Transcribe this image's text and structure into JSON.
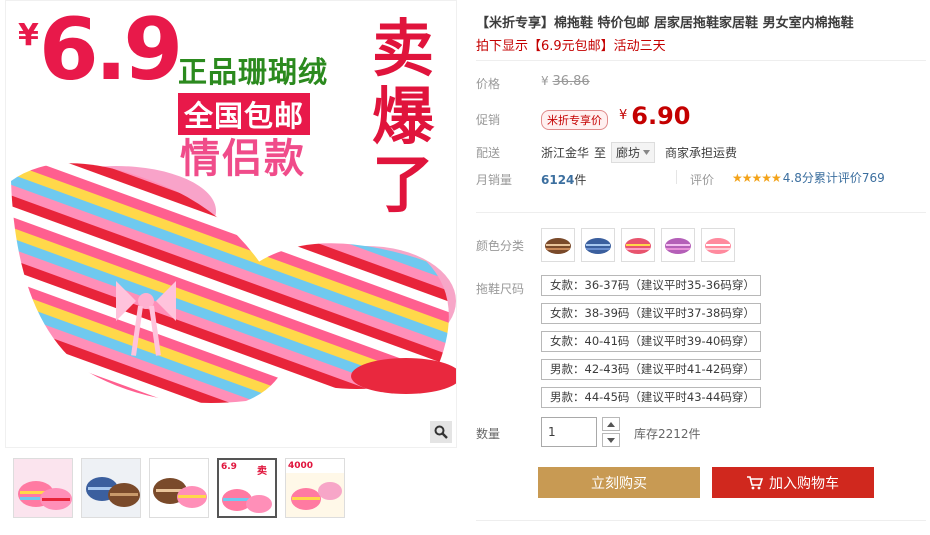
{
  "gallery": {
    "promo": {
      "yen": "¥",
      "price": "6.9",
      "line1": "正品珊瑚绒",
      "line2": "全国包邮",
      "line3": "情侣款",
      "vertical": "卖爆了"
    },
    "thumb4_caption": "6.9",
    "thumb5_caption": "4000"
  },
  "product": {
    "title": "【米折专享】棉拖鞋 特价包邮 居家居拖鞋家居鞋 男女室内棉拖鞋",
    "subtitle": "拍下显示【6.9元包邮】活动三天",
    "price_label": "价格",
    "orig_yen": "¥",
    "orig_price": "36.86",
    "promo_label": "促销",
    "promo_tag": "米折专享价",
    "cur_yen": "¥",
    "cur_price": "6.90",
    "ship_label": "配送",
    "ship_from": "浙江金华",
    "ship_to": "至",
    "ship_city": "廊坊",
    "ship_fee": "商家承担运费",
    "sales_label": "月销量",
    "sales_count": "6124",
    "sales_unit": "件",
    "rating_label": "评价",
    "rating_stars": "★★★★★",
    "rating_text": "4.8分累计评价769",
    "color_label": "颜色分类",
    "size_label": "拖鞋尺码",
    "sizes": [
      "女款：36-37码（建议平时35-36码穿）",
      "女款：38-39码（建议平时37-38码穿）",
      "女款：40-41码（建议平时39-40码穿）",
      "男款：42-43码（建议平时41-42码穿）",
      "男款：44-45码（建议平时43-44码穿）"
    ],
    "qty_label": "数量",
    "qty_value": "1",
    "stock": "库存2212件",
    "buy_label": "立刻购买",
    "cart_label": "加入购物车"
  },
  "icons": {
    "zoom": "magnifier-icon",
    "cart": "cart-icon",
    "dropdown": "triangle-down-icon"
  },
  "colors": {
    "price_red": "#c40000",
    "buy_btn": "#c89a53",
    "cart_btn": "#d0281e",
    "promo_pink": "#e8194a",
    "promo_green": "#2b8a1e"
  }
}
